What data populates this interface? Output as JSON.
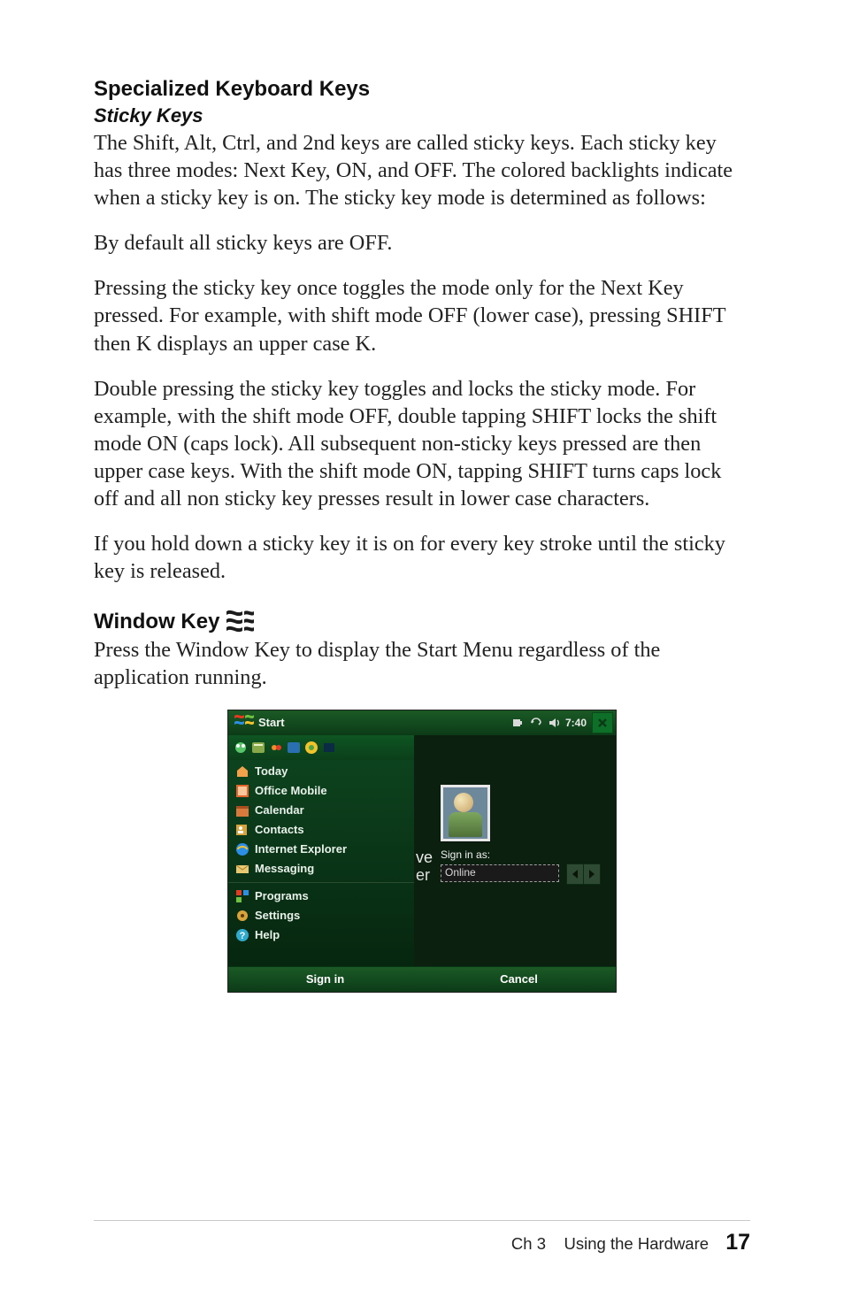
{
  "headings": {
    "specialized": "Specialized Keyboard Keys",
    "sticky": "Sticky Keys",
    "window": "Window Key"
  },
  "paragraphs": {
    "p1": "The Shift, Alt, Ctrl, and 2nd keys are called sticky keys. Each sticky key has three modes: Next Key, ON, and OFF. The colored backlights indicate when a sticky key is on. The sticky key mode is determined as follows:",
    "p2": "By default all sticky keys are OFF.",
    "p3": "Pressing the sticky key once toggles the mode only for the Next Key pressed. For example, with shift mode OFF (lower case), pressing SHIFT then K displays an upper case K.",
    "p4": "Double pressing the sticky key toggles and locks the sticky mode. For example, with the shift mode OFF, double tapping SHIFT locks the shift mode ON (caps lock). All subsequent non-sticky keys pressed are then upper case keys. With the shift mode ON, tapping SHIFT turns caps lock off and all non sticky key presses result in lower case characters.",
    "p5": "If you hold down a sticky key it is on for every key stroke until the sticky key is released.",
    "p6": "Press the Window Key to display the Start Menu regardless of the application running."
  },
  "screenshot": {
    "topbar": {
      "title": "Start",
      "time": "7:40"
    },
    "menu": {
      "items": [
        {
          "id": "today",
          "label": "Today"
        },
        {
          "id": "office",
          "label": "Office Mobile"
        },
        {
          "id": "calendar",
          "label": "Calendar"
        },
        {
          "id": "contacts",
          "label": "Contacts"
        },
        {
          "id": "ie",
          "label": "Internet Explorer"
        },
        {
          "id": "msg",
          "label": "Messaging"
        },
        {
          "id": "programs",
          "label": "Programs"
        },
        {
          "id": "settings",
          "label": "Settings"
        },
        {
          "id": "help",
          "label": "Help"
        }
      ]
    },
    "pane": {
      "frag1": "ve",
      "frag2": "er",
      "signin_label": "Sign in as:",
      "status_value": "Online"
    },
    "softkeys": {
      "left": "Sign in",
      "right": "Cancel"
    }
  },
  "footer": {
    "chapter": "Ch 3",
    "title": "Using the Hardware",
    "page": "17"
  }
}
